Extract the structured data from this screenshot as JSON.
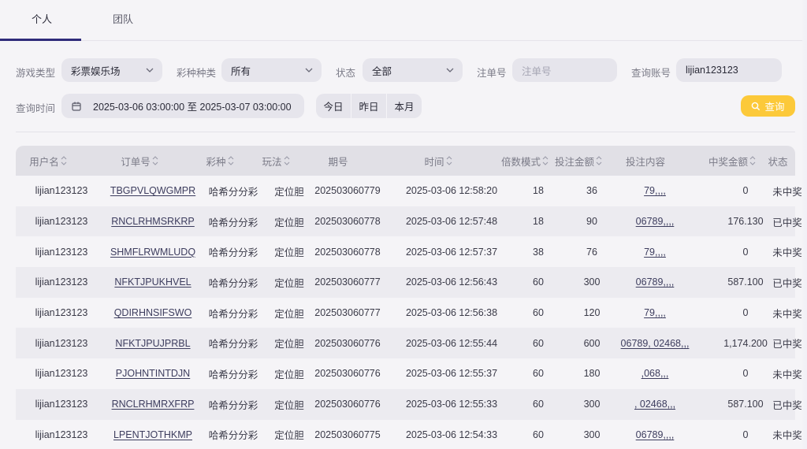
{
  "tabs": [
    {
      "label": "个人",
      "active": true
    },
    {
      "label": "团队",
      "active": false
    }
  ],
  "filters": {
    "game_type": {
      "label": "游戏类型",
      "value": "彩票娱乐场"
    },
    "lottery_type": {
      "label": "彩种种类",
      "value": "所有"
    },
    "status": {
      "label": "状态",
      "value": "全部"
    },
    "order_no": {
      "label": "注单号",
      "placeholder": "注单号"
    },
    "account": {
      "label": "查询账号",
      "value": "lijian123123"
    },
    "time": {
      "label": "查询时间",
      "value": "2025-03-06 03:00:00 至 2025-03-07 03:00:00"
    },
    "quick": [
      "今日",
      "昨日",
      "本月"
    ],
    "search_label": "查询"
  },
  "table": {
    "headers": [
      "用户名",
      "订单号",
      "彩种",
      "玩法",
      "期号",
      "时间",
      "倍数模式",
      "投注金额",
      "投注内容",
      "中奖金额",
      "状态"
    ],
    "rows": [
      [
        "lijian123123",
        "TBGPVLQWGMPR",
        "哈希分分彩",
        "定位胆",
        "202503060779",
        "2025-03-06 12:58:20",
        "18",
        "36",
        "79,,,,",
        "0",
        "未中奖"
      ],
      [
        "lijian123123",
        "RNCLRHMSRKRP",
        "哈希分分彩",
        "定位胆",
        "202503060778",
        "2025-03-06 12:57:48",
        "18",
        "90",
        "06789,,,,",
        "176.130",
        "已中奖"
      ],
      [
        "lijian123123",
        "SHMFLRWMLUDQ",
        "哈希分分彩",
        "定位胆",
        "202503060778",
        "2025-03-06 12:57:37",
        "38",
        "76",
        "79,,,,",
        "0",
        "未中奖"
      ],
      [
        "lijian123123",
        "NFKTJPUKHVEL",
        "哈希分分彩",
        "定位胆",
        "202503060777",
        "2025-03-06 12:56:43",
        "60",
        "300",
        "06789,,,,",
        "587.100",
        "已中奖"
      ],
      [
        "lijian123123",
        "QDIRHNSIFSWO",
        "哈希分分彩",
        "定位胆",
        "202503060777",
        "2025-03-06 12:56:38",
        "60",
        "120",
        "79,,,,",
        "0",
        "未中奖"
      ],
      [
        "lijian123123",
        "NFKTJPUJPRBL",
        "哈希分分彩",
        "定位胆",
        "202503060776",
        "2025-03-06 12:55:44",
        "60",
        "600",
        "06789, 02468,,,",
        "1,174.200",
        "已中奖"
      ],
      [
        "lijian123123",
        "PJOHNTINTDJN",
        "哈希分分彩",
        "定位胆",
        "202503060776",
        "2025-03-06 12:55:37",
        "60",
        "180",
        ",068,,,",
        "0",
        "未中奖"
      ],
      [
        "lijian123123",
        "RNCLRHMRXFRP",
        "哈希分分彩",
        "定位胆",
        "202503060776",
        "2025-03-06 12:55:33",
        "60",
        "300",
        ", 02468,,,",
        "587.100",
        "已中奖"
      ],
      [
        "lijian123123",
        "LPENTJOTHKMP",
        "哈希分分彩",
        "定位胆",
        "202503060775",
        "2025-03-06 12:54:33",
        "60",
        "300",
        "06789,,,,",
        "0",
        "未中奖"
      ]
    ]
  }
}
